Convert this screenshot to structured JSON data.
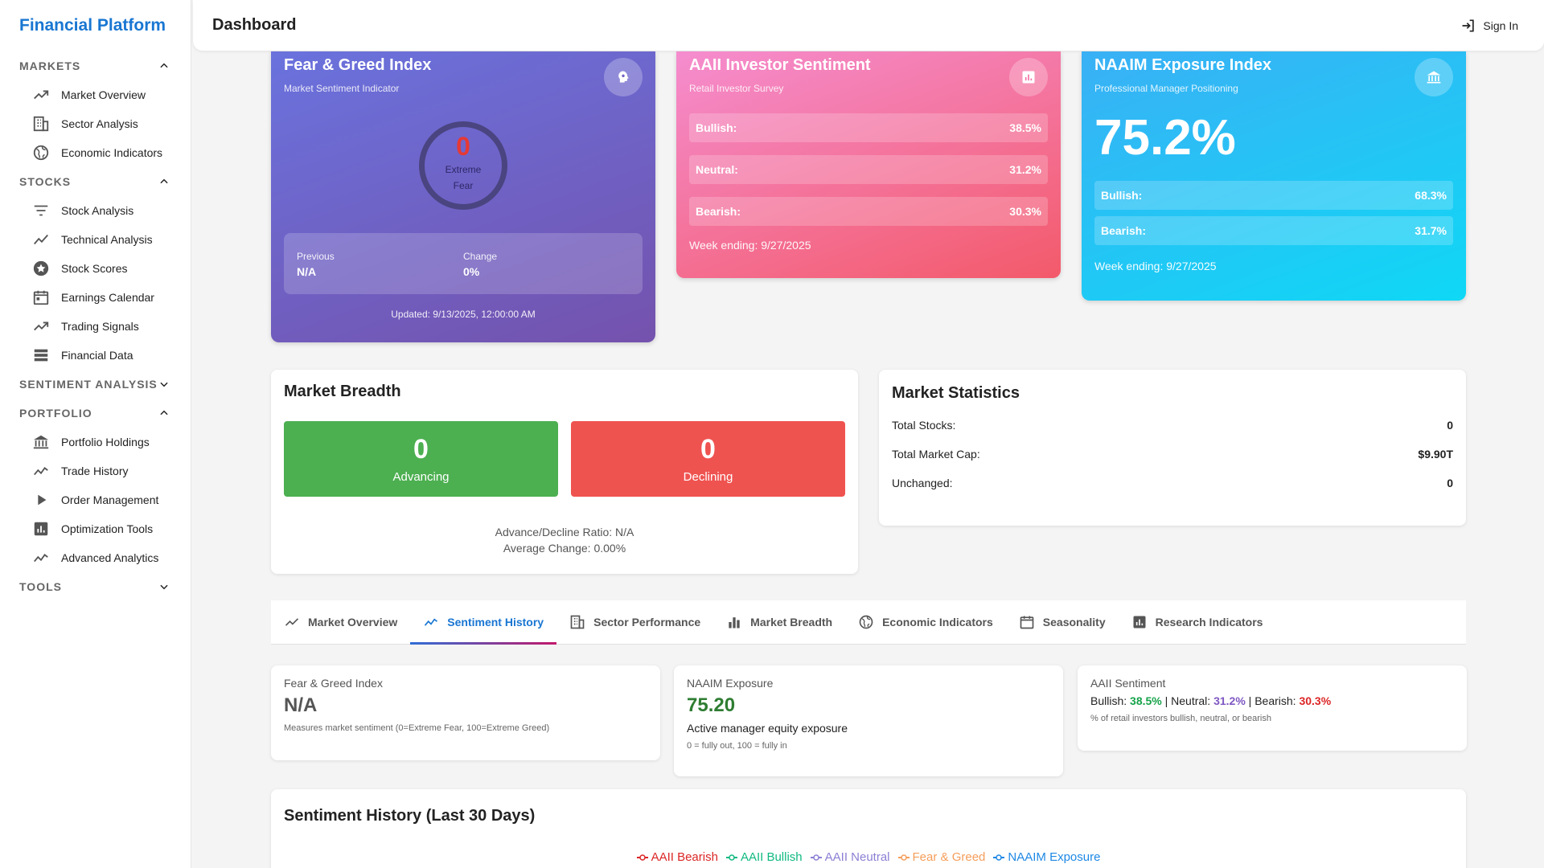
{
  "sidebar": {
    "brand": "Financial Platform",
    "sections": [
      {
        "label": "MARKETS",
        "items": [
          "Market Overview",
          "Sector Analysis",
          "Economic Indicators"
        ]
      },
      {
        "label": "STOCKS",
        "items": [
          "Stock Analysis",
          "Technical Analysis",
          "Stock Scores",
          "Earnings Calendar",
          "Trading Signals",
          "Financial Data"
        ]
      },
      {
        "label": "SENTIMENT ANALYSIS",
        "items": []
      },
      {
        "label": "PORTFOLIO",
        "items": [
          "Portfolio Holdings",
          "Trade History",
          "Order Management",
          "Optimization Tools",
          "Advanced Analytics"
        ]
      },
      {
        "label": "TOOLS",
        "items": []
      }
    ]
  },
  "header": {
    "title": "Dashboard",
    "signin": "Sign In"
  },
  "fear_greed": {
    "title": "Fear & Greed Index",
    "subtitle": "Market Sentiment Indicator",
    "value": "0",
    "label": "Extreme Fear",
    "previous_label": "Previous",
    "previous_value": "N/A",
    "change_label": "Change",
    "change_value": "0%",
    "updated": "Updated: 9/13/2025, 12:00:00 AM"
  },
  "aaii": {
    "title": "AAII Investor Sentiment",
    "subtitle": "Retail Investor Survey",
    "rows": [
      {
        "label": "Bullish:",
        "value": "38.5%"
      },
      {
        "label": "Neutral:",
        "value": "31.2%"
      },
      {
        "label": "Bearish:",
        "value": "30.3%"
      }
    ],
    "week": "Week ending: 9/27/2025"
  },
  "naaim": {
    "title": "NAAIM Exposure Index",
    "subtitle": "Professional Manager Positioning",
    "big": "75.2%",
    "rows": [
      {
        "label": "Bullish:",
        "value": "68.3%"
      },
      {
        "label": "Bearish:",
        "value": "31.7%"
      }
    ],
    "week": "Week ending: 9/27/2025"
  },
  "breadth": {
    "title": "Market Breadth",
    "advancing_value": "0",
    "advancing_label": "Advancing",
    "declining_value": "0",
    "declining_label": "Declining",
    "ratio": "Advance/Decline Ratio: N/A",
    "avg_change": "Average Change: 0.00%"
  },
  "stats": {
    "title": "Market Statistics",
    "rows": [
      {
        "label": "Total Stocks:",
        "value": "0"
      },
      {
        "label": "Total Market Cap:",
        "value": "$9.90T"
      },
      {
        "label": "Unchanged:",
        "value": "0"
      }
    ]
  },
  "tabs": [
    "Market Overview",
    "Sentiment History",
    "Sector Performance",
    "Market Breadth",
    "Economic Indicators",
    "Seasonality",
    "Research Indicators"
  ],
  "active_tab": 1,
  "mini": {
    "fg": {
      "title": "Fear & Greed Index",
      "value": "N/A",
      "desc": "Measures market sentiment (0=Extreme Fear, 100=Extreme Greed)"
    },
    "naaim": {
      "title": "NAAIM Exposure",
      "value": "75.20",
      "act": "Active manager equity exposure",
      "desc": "0 = fully out, 100 = fully in"
    },
    "aaii": {
      "title": "AAII Sentiment",
      "bull_label": "Bullish:",
      "bull": "38.5%",
      "neut_label": "Neutral:",
      "neut": "31.2%",
      "bear_label": "Bearish:",
      "bear": "30.3%",
      "sep": "|",
      "desc": "% of retail investors bullish, neutral, or bearish"
    }
  },
  "history": {
    "title": "Sentiment History (Last 30 Days)",
    "legend": [
      {
        "name": "AAII Bearish",
        "color": "#dc2626"
      },
      {
        "name": "AAII Bullish",
        "color": "#10b981"
      },
      {
        "name": "AAII Neutral",
        "color": "#8b7fd4"
      },
      {
        "name": "Fear & Greed",
        "color": "#f59e5b"
      },
      {
        "name": "NAAIM Exposure",
        "color": "#1e88e5"
      }
    ]
  },
  "colors": {
    "brand": "#1976d2",
    "advancing": "#4caf50",
    "declining": "#ef5350"
  }
}
